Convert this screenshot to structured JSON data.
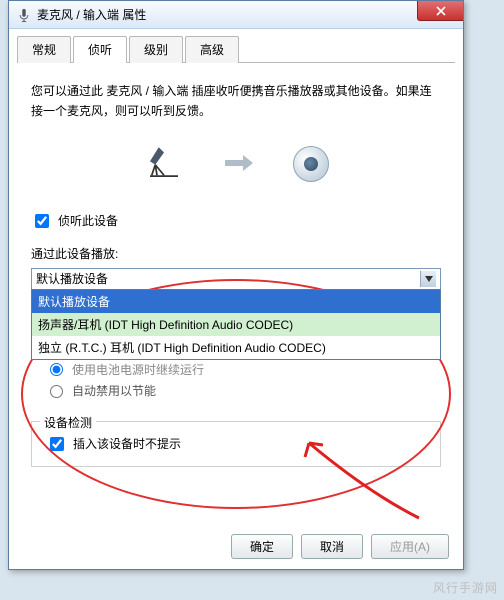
{
  "window": {
    "title": "麦克风 / 输入端 属性"
  },
  "tabs": [
    "常规",
    "侦听",
    "级别",
    "高级"
  ],
  "active_tab": 1,
  "desc": "您可以通过此 麦克风 / 输入端 插座收听便携音乐播放器或其他设备。如果连接一个麦克风，则可以听到反馈。",
  "listen_checkbox": {
    "label": "侦听此设备",
    "checked": true
  },
  "playback_label": "通过此设备播放:",
  "combo_value": "默认播放设备",
  "dropdown_options": [
    "默认播放设备",
    "扬声器/耳机 (IDT High Definition Audio CODEC)",
    "独立 (R.T.C.) 耳机 (IDT High Definition Audio CODEC)"
  ],
  "dropdown_selected_index": 0,
  "radio_partial_text": "使用电池电源时继续运行",
  "radio_option2": "自动禁用以节能",
  "detect_group": {
    "legend": "设备检测",
    "checkbox_label": "插入该设备时不提示",
    "checked": true
  },
  "buttons": {
    "ok": "确定",
    "cancel": "取消",
    "apply": "应用(A)"
  },
  "watermark": "风行手游网"
}
